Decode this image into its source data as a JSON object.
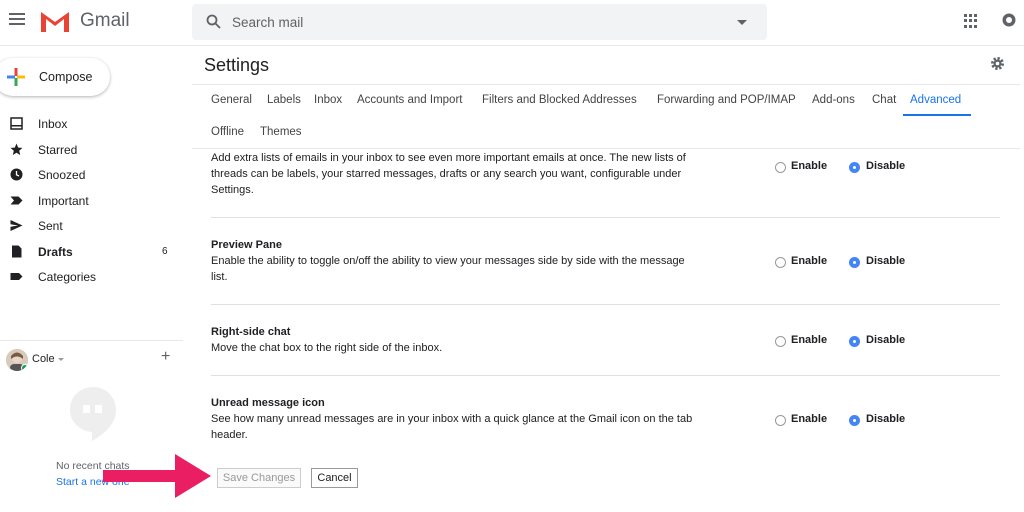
{
  "app": {
    "brand": "Gmail",
    "colors": {
      "accent": "#1a73e8",
      "radio_on": "#4285f4",
      "arrow": "#e91e63",
      "logo_red": "#ea4335"
    }
  },
  "search": {
    "placeholder": "Search mail"
  },
  "compose": {
    "label": "Compose"
  },
  "nav": [
    {
      "label": "Inbox",
      "icon": "inbox-icon",
      "count": "",
      "bold": false
    },
    {
      "label": "Starred",
      "icon": "star-icon",
      "count": "",
      "bold": false
    },
    {
      "label": "Snoozed",
      "icon": "clock-icon",
      "count": "",
      "bold": false
    },
    {
      "label": "Important",
      "icon": "important-icon",
      "count": "",
      "bold": false
    },
    {
      "label": "Sent",
      "icon": "send-icon",
      "count": "",
      "bold": false
    },
    {
      "label": "Drafts",
      "icon": "draft-icon",
      "count": "6",
      "bold": true
    },
    {
      "label": "Categories",
      "icon": "label-icon",
      "count": "",
      "bold": false
    }
  ],
  "user": {
    "name": "Cole"
  },
  "hangouts": {
    "no_chats": "No recent chats",
    "start_new": "Start a new one"
  },
  "settings": {
    "title": "Settings",
    "tabs": [
      "General",
      "Labels",
      "Inbox",
      "Accounts and Import",
      "Filters and Blocked Addresses",
      "Forwarding and POP/IMAP",
      "Add-ons",
      "Chat",
      "Advanced",
      "Offline",
      "Themes"
    ],
    "active_tab": "Advanced",
    "options": {
      "enable": "Enable",
      "disable": "Disable"
    },
    "rows": [
      {
        "title": "",
        "desc": "Add extra lists of emails in your inbox to see even more important emails at once. The new lists of threads can be labels, your starred messages, drafts or any search you want, configurable under Settings.",
        "selected": "Disable"
      },
      {
        "title": "Preview Pane",
        "desc": "Enable the ability to toggle on/off the ability to view your messages side by side with the message list.",
        "selected": "Disable"
      },
      {
        "title": "Right-side chat",
        "desc": "Move the chat box to the right side of the inbox.",
        "selected": "Disable"
      },
      {
        "title": "Unread message icon",
        "desc": "See how many unread messages are in your inbox with a quick glance at the Gmail icon on the tab header.",
        "selected": "Disable"
      }
    ],
    "save_label": "Save Changes",
    "cancel_label": "Cancel"
  }
}
